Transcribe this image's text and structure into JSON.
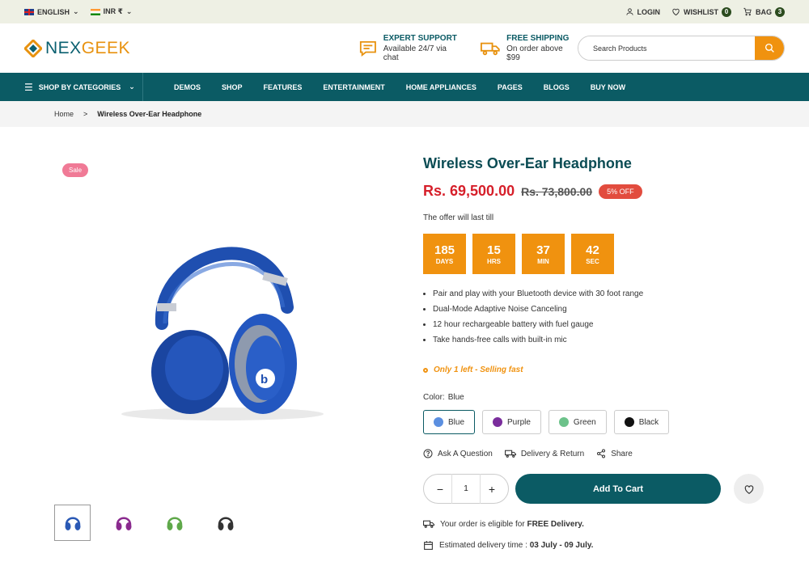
{
  "topbar": {
    "language": "ENGLISH",
    "currency": "INR ₹",
    "login": "LOGIN",
    "wishlist": "WISHLIST",
    "wishlist_count": "0",
    "bag": "BAG",
    "bag_count": "3"
  },
  "header": {
    "logo_part1": "NEX",
    "logo_part2": "GEEK",
    "support_title": "EXPERT SUPPORT",
    "support_sub": "Available 24/7 via chat",
    "shipping_title": "FREE SHIPPING",
    "shipping_sub": "On order above $99",
    "search_placeholder": "Search Products"
  },
  "nav": {
    "categories": "SHOP BY CATEGORIES",
    "items": [
      "DEMOS",
      "SHOP",
      "FEATURES",
      "ENTERTAINMENT",
      "HOME APPLIANCES",
      "PAGES",
      "BLOGS",
      "BUY NOW"
    ]
  },
  "breadcrumb": {
    "home": "Home",
    "sep": ">",
    "current": "Wireless Over-Ear Headphone"
  },
  "product": {
    "sale": "Sale",
    "title": "Wireless Over-Ear Headphone",
    "price": "Rs. 69,500.00",
    "old_price": "Rs. 73,800.00",
    "discount": "5% OFF",
    "offer_text": "The offer will last till",
    "countdown": [
      {
        "n": "185",
        "l": "DAYS"
      },
      {
        "n": "15",
        "l": "HRS"
      },
      {
        "n": "37",
        "l": "MIN"
      },
      {
        "n": "42",
        "l": "SEC"
      }
    ],
    "features": [
      "Pair and play with your Bluetooth device with 30 foot range",
      "Dual-Mode Adaptive Noise Canceling",
      "12 hour rechargeable battery with fuel gauge",
      "Take hands-free calls with built-in mic"
    ],
    "stock": "Only 1 left - Selling fast",
    "color_label": "Color:",
    "color_value": "Blue",
    "colors": [
      {
        "name": "Blue",
        "hex": "#5b8fe0"
      },
      {
        "name": "Purple",
        "hex": "#7a2d9c"
      },
      {
        "name": "Green",
        "hex": "#6cc28a"
      },
      {
        "name": "Black",
        "hex": "#111111"
      }
    ],
    "ask": "Ask A Question",
    "delivery_return": "Delivery & Return",
    "share": "Share",
    "quantity": "1",
    "add_to_cart": "Add To Cart",
    "delivery_note_pre": "Your order is eligible for",
    "delivery_note_bold": "FREE Delivery.",
    "est_pre": "Estimated delivery time :",
    "est_bold": "03 July - 09 July."
  },
  "thumb_colors": [
    "#2a59b5",
    "#8a2a8e",
    "#5fa84a",
    "#333333"
  ]
}
